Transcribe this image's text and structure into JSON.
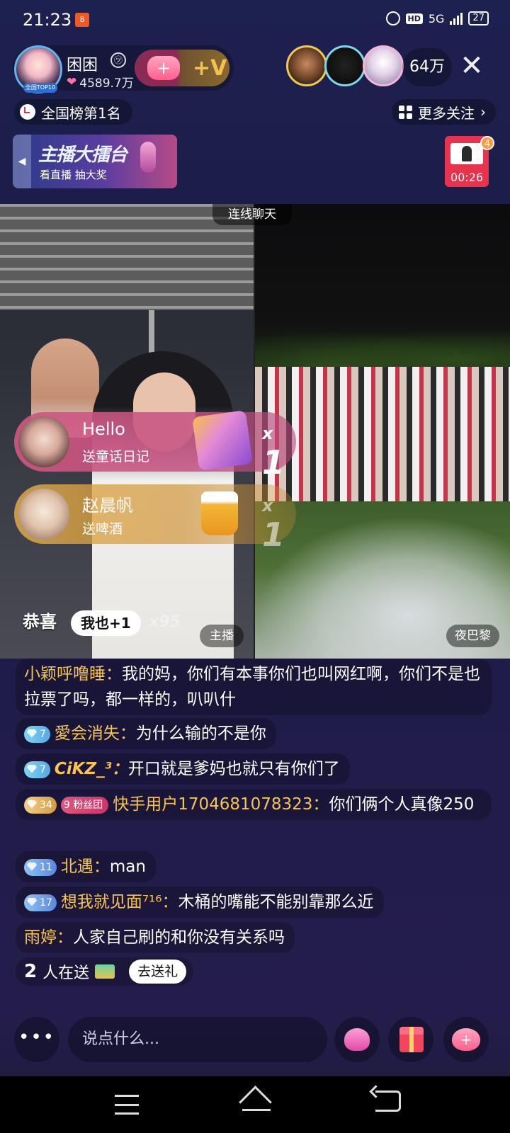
{
  "status_bar": {
    "time": "21:23",
    "app_icon_label": "8",
    "hd": "HD",
    "network": "5G",
    "battery": "27"
  },
  "anchor": {
    "name": "困困",
    "verify_icon": "㋡",
    "likes": "4589.7万",
    "badge": "全国TOP10"
  },
  "follow": {
    "heart_label": "+",
    "v_label": "+V"
  },
  "top_viewers": {
    "count": "64万"
  },
  "close_label": "✕",
  "rank": {
    "label": "全国榜第1名"
  },
  "more_follow": {
    "label": "更多关注",
    "chevron": "›"
  },
  "banner": {
    "title": "主播大擂台",
    "subtitle": "看直播 抽大奖"
  },
  "gift_timer": {
    "badge": "4",
    "time": "00:26"
  },
  "video": {
    "connect_tag": "连线聊天",
    "host_tag": "主播",
    "opponent_tag": "夜巴黎"
  },
  "gift_notifications": [
    {
      "sender": "Hello",
      "desc": "送童话日记",
      "count_prefix": "x",
      "count": "1"
    },
    {
      "sender": "赵晨帆",
      "desc": "送啤酒",
      "count_prefix": "x",
      "count": "1"
    }
  ],
  "congrats": {
    "label": "恭喜",
    "button": "我也+1",
    "count": "x95"
  },
  "chat": [
    {
      "user": "小颖呼噜睡：",
      "text": "我的妈，你们有本事你们也叫网红啊，你们不是也拉票了吗，都一样的，叭叭什"
    },
    {
      "level": "7",
      "user": "愛会消失：",
      "text": "为什么输的不是你"
    },
    {
      "level": "7",
      "user": "CiKZ_³：",
      "text": "开口就是爹妈也就只有你们了"
    },
    {
      "level": "34",
      "fans_level": "9",
      "fans_label": "粉丝团",
      "user": "快手用户1704681078323：",
      "text": "你们俩个人真像250"
    },
    {
      "level": "11",
      "user": "北遇：",
      "text": "man"
    },
    {
      "level": "17",
      "user": "想我就见面⁷¹⁶：",
      "text": "木桶的嘴能不能别靠那么近"
    },
    {
      "user": "雨婷：",
      "text": "人家自己刷的和你没有关系吗"
    }
  ],
  "sending": {
    "count": "2",
    "label": "人在送",
    "button": "去送礼"
  },
  "input": {
    "more": "•••",
    "placeholder": "说点什么...",
    "heart_plus": "+"
  }
}
